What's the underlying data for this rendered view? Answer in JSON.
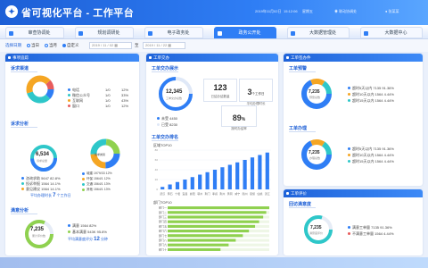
{
  "header": {
    "logo": "✦",
    "title": "省可视化平台 - 工作平台",
    "date": "2019年11月02日",
    "time": "15:12:06",
    "weekday": "星期五",
    "link": "联动协调处",
    "user": "张某某"
  },
  "nav": {
    "tabs": [
      "审查协调处",
      "规划调研处",
      "电子政务处",
      "政务公开处",
      "大数据管理处",
      "大数据中心"
    ],
    "active": 3
  },
  "filter": {
    "label": "选择日期",
    "options": [
      "当日",
      "当月",
      "自定义"
    ],
    "selected": 2,
    "start": "2019 / 11 / 02",
    "sep": "至",
    "end": "2019 / 11 / 22"
  },
  "left": {
    "header": "事项追踪",
    "s1": {
      "title": "诉求渠道",
      "items": [
        {
          "label": "电话",
          "value": "1/0",
          "pct": "12%",
          "color": "#2f7ef5"
        },
        {
          "label": "微信公众号",
          "value": "1/0",
          "pct": "33%",
          "color": "#2ec7c9"
        },
        {
          "label": "互联网",
          "value": "1/0",
          "pct": "43%",
          "color": "#f5a623"
        },
        {
          "label": "窗口",
          "value": "1/0",
          "pct": "12%",
          "color": "#e85c5c"
        }
      ]
    },
    "s2": {
      "title": "诉求分析",
      "total": "6,534",
      "total_label": "诉求总量",
      "cat_label": "诉求类别",
      "items": [
        {
          "label": "咨询求助",
          "value": "5647",
          "pct": "82.8%"
        },
        {
          "label": "投诉举报",
          "value": "1564",
          "pct": "14.1%"
        },
        {
          "label": "意见建议",
          "value": "1564",
          "pct": "14.1%"
        }
      ],
      "avg_label": "平均办理时长",
      "avg_value": "7",
      "avg_unit": "个工作日",
      "cats": [
        {
          "label": "城建",
          "value": "1979/33",
          "pct": "12%"
        },
        {
          "label": "环保",
          "value": "1564/1",
          "pct": "12%"
        },
        {
          "label": "交通",
          "value": "1564/1",
          "pct": "13%"
        },
        {
          "label": "其他",
          "value": "1564/1",
          "pct": "13%"
        }
      ]
    },
    "s3": {
      "title": "满意分析",
      "total": "7,235",
      "total_label": "累计评价数",
      "items": [
        {
          "label": "满意",
          "value": "1564",
          "pct": "82%"
        },
        {
          "label": "基本满意",
          "value": "543K",
          "pct": "95.8%"
        }
      ],
      "avg_label": "平均满意度评分",
      "avg_value": "12",
      "avg_unit": "分钟"
    }
  },
  "mid": {
    "header": "工单交办",
    "s1": {
      "title": "工单交办展示",
      "total": "12,345",
      "total_label": "工单交办总数",
      "legend": [
        {
          "label": "未受",
          "value": "4450"
        },
        {
          "label": "已受",
          "value": "8230"
        }
      ],
      "kpis": [
        {
          "value": "123",
          "label": "已结办结数量"
        },
        {
          "value": "3",
          "unit": "个工作日",
          "label": "平均办理时长"
        },
        {
          "value": "89",
          "unit": "%",
          "label": "按时办结率"
        }
      ]
    },
    "s2": {
      "title": "工单交办排名",
      "chart1": "区域TOP10",
      "chart2": "部门TOP10"
    }
  },
  "right": {
    "header": "工单签办件",
    "s1": {
      "title": "工单预警",
      "total": "7,235",
      "total_label": "预警总数",
      "items": [
        {
          "label": "超时5天以内",
          "value": "7135",
          "pct": "91.36%"
        },
        {
          "label": "超时10天以内",
          "value": "1564",
          "pct": "4.44%"
        },
        {
          "label": "超时15天以内",
          "value": "1564",
          "pct": "4.44%"
        }
      ]
    },
    "s2": {
      "title": "工单办理",
      "total": "7,235",
      "total_label": "办理总数",
      "items": [
        {
          "label": "超时5天以内",
          "value": "7135",
          "pct": "91.36%"
        },
        {
          "label": "超时10天以内",
          "value": "1564",
          "pct": "4.44%"
        },
        {
          "label": "超时15天以内",
          "value": "1564",
          "pct": "4.44%"
        }
      ]
    },
    "header2": "工单评价",
    "s3": {
      "title": "回访满意度",
      "total": "7,235",
      "total_label": "满意度评价",
      "items": [
        {
          "label": "满意工单量",
          "value": "7135",
          "pct": "91.36%"
        },
        {
          "label": "不满意工单量",
          "value": "1564",
          "pct": "4.44%"
        }
      ]
    }
  },
  "chart_data": [
    {
      "type": "bar",
      "title": "区域TOP10",
      "categories": [
        "武汉",
        "黄石",
        "十堰",
        "宜昌",
        "襄阳",
        "鄂州",
        "荆门",
        "孝感",
        "荆州",
        "黄冈",
        "咸宁",
        "随州",
        "恩施",
        "仙桃",
        "潜江"
      ],
      "values": [
        5,
        10,
        15,
        20,
        25,
        30,
        35,
        40,
        45,
        50,
        55,
        60,
        65,
        70,
        75
      ],
      "ylim": [
        0,
        80
      ],
      "color": "#2f7ef5"
    },
    {
      "type": "bar",
      "title": "部门TOP10",
      "orientation": "horizontal",
      "categories": [
        "部门一",
        "部门二",
        "部门三",
        "部门四",
        "部门五",
        "部门六",
        "部门七",
        "部门八",
        "部门九",
        "部门十"
      ],
      "values": [
        100,
        97,
        94,
        90,
        86,
        80,
        74,
        67,
        60,
        52
      ],
      "xlim": [
        0,
        100
      ],
      "color": "#8fd14f"
    }
  ]
}
